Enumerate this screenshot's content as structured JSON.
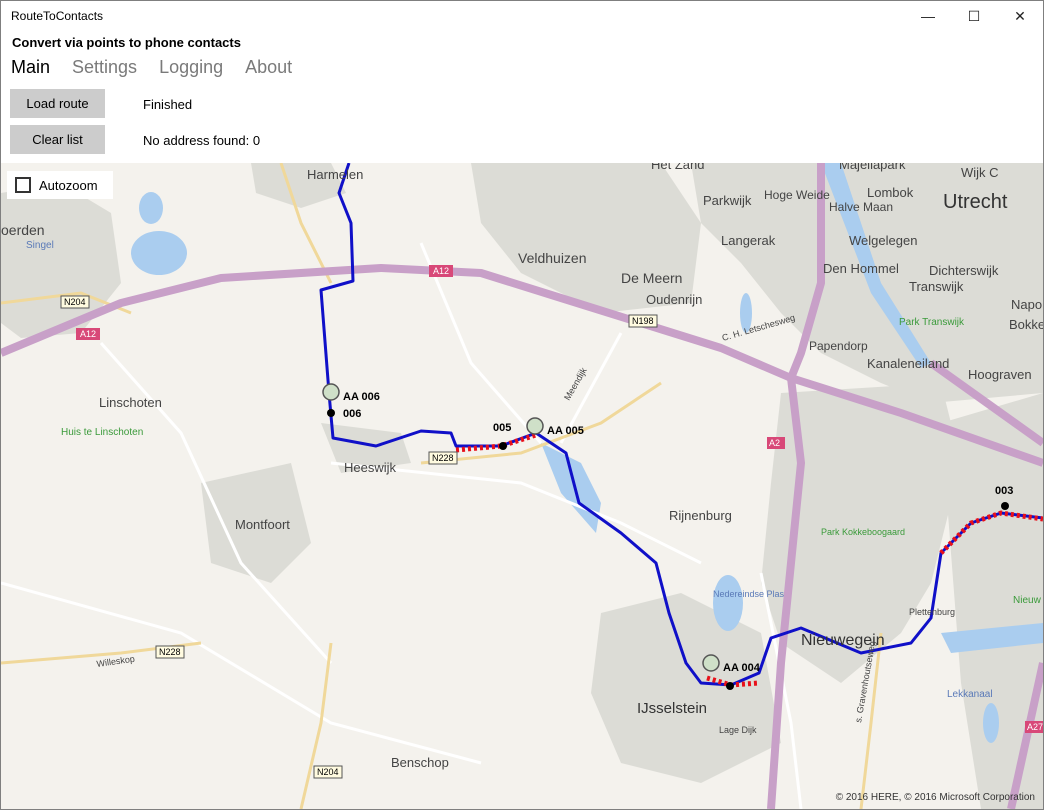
{
  "window": {
    "title": "RouteToContacts",
    "controls": {
      "minimize": "—",
      "maximize": "☐",
      "close": "✕"
    }
  },
  "header": {
    "title": "Convert via points to phone contacts"
  },
  "tabs": [
    {
      "label": "Main",
      "active": true
    },
    {
      "label": "Settings",
      "active": false
    },
    {
      "label": "Logging",
      "active": false
    },
    {
      "label": "About",
      "active": false
    }
  ],
  "actions": {
    "load_route_label": "Load route",
    "load_route_status": "Finished",
    "clear_list_label": "Clear list",
    "clear_list_status": "No address found: 0"
  },
  "map": {
    "autozoom_label": "Autozoom",
    "autozoom_checked": false,
    "copyright": "© 2016 HERE, © 2016 Microsoft Corporation",
    "places": {
      "utrecht": "Utrecht",
      "harmelen": "Harmelen",
      "woerden": "oerden",
      "veldhuizen": "Veldhuizen",
      "de_meern": "De Meern",
      "oudenrijn": "Oudenrijn",
      "linschoten": "Linschoten",
      "huis_te_linschoten": "Huis te Linschoten",
      "heeswijk": "Heeswijk",
      "montfoort": "Montfoort",
      "rijnenburg": "Rijnenburg",
      "nieuwegein": "Nieuwegein",
      "ijsselstein": "IJsselstein",
      "benschop": "Benschop",
      "papendorp": "Papendorp",
      "kanaleneiland": "Kanaleneiland",
      "hoograven": "Hoograven",
      "transwijk": "Transwijk",
      "dichterswijk": "Dichterswijk",
      "den_hommel": "Den Hommel",
      "welgelegen": "Welgelegen",
      "halve_maan": "Halve Maan",
      "lombok": "Lombok",
      "parkwijk": "Parkwijk",
      "hoge_weide": "Hoge Weide",
      "langerak": "Langerak",
      "het_zand": "Het Zand",
      "majellapark": "Majellapark",
      "wijk_c": "Wijk C",
      "plettenburg": "Plettenburg",
      "lekkanaal": "Lekkanaal",
      "nedereindse_plas": "Nedereindse Plas",
      "lage_dijk": "Lage Dijk",
      "park_kokkebogaard": "Park Kokkeboogaard",
      "meendijk": "Meendijk",
      "letschesweg": "C. H. Letschesweg",
      "graventhoutseweg": "s. Gravenhoutseweg",
      "willeskop": "Willeskop",
      "singel": "Singel",
      "park_transwijk": "Park Transwijk",
      "napo": "Napo",
      "bokke": "Bokke",
      "nieuw": "Nieuw"
    },
    "road_shields": {
      "a12_left": "A12",
      "a12_center": "A12",
      "a2": "A2",
      "a27": "A27",
      "n204_top": "N204",
      "n204_bottom": "N204",
      "n198": "N198",
      "n228_center": "N228",
      "n228_left": "N228"
    },
    "waypoints": {
      "aa006": "AA 006",
      "p006": "006",
      "aa005": "AA 005",
      "p005": "005",
      "aa004": "AA 004",
      "p003": "003"
    },
    "colors": {
      "route": "#1010c8",
      "deviation": "#e8101a",
      "highway": "#c8a0c8",
      "water": "#aacdef",
      "urban": "#dcdcd6"
    }
  }
}
